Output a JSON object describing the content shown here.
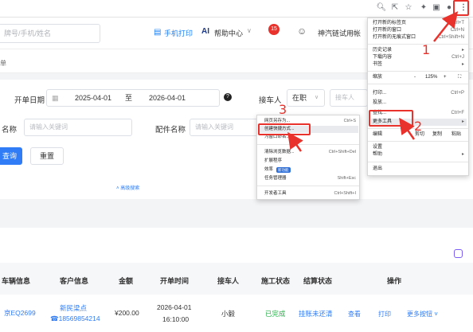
{
  "header": {
    "search_placeholder": "牌号/手机/姓名",
    "print_label": "手机打印",
    "help_label": "帮助中心",
    "notice_count": "15",
    "company": "神汽链试用帐"
  },
  "subbar": {
    "crumb": "单"
  },
  "filters": {
    "open_date_label": "开单日期",
    "date_from": "2025-04-01",
    "date_sep": "至",
    "date_to": "2026-04-01",
    "receiver_label": "接车人",
    "receiver_status": "在职",
    "receiver_placeholder": "接车人",
    "name_label": "名称",
    "name_placeholder": "请输入关键词",
    "part_label": "配件名称",
    "part_placeholder": "请输入关键词",
    "query_button": "查询",
    "reset_button": "重置",
    "advanced_search": "高级搜索"
  },
  "table": {
    "headers": [
      "车辆信息",
      "客户信息",
      "金额",
      "开单时间",
      "接车人",
      "施工状态",
      "结算状态",
      "操作"
    ],
    "row": {
      "vehicle": "京EQ2699",
      "customer_name": "新民梁点",
      "customer_phone": "18569854214",
      "amount": "¥200.00",
      "date": "2026-04-01",
      "time": "16:10:00",
      "receiver": "小毅",
      "work_status": "已完成",
      "settle_status": "挂账未还清",
      "action_view": "查看",
      "action_print": "打印",
      "action_more": "更多按钮"
    }
  },
  "chrome_menu": {
    "new_tab": "打开新的标签页",
    "new_tab_sc": "Ctrl+T",
    "new_window": "打开新的窗口",
    "new_window_sc": "Ctrl+N",
    "incognito": "打开新的无痕式窗口",
    "incognito_sc": "Ctrl+Shift+N",
    "history": "历史记录",
    "downloads": "下载内容",
    "downloads_sc": "Ctrl+J",
    "bookmarks": "书签",
    "zoom_label": "缩放",
    "zoom_minus": "-",
    "zoom_value": "125%",
    "zoom_plus": "+",
    "print": "打印...",
    "print_sc": "Ctrl+P",
    "cast": "投放...",
    "find": "查找...",
    "find_sc": "Ctrl+F",
    "more_tools": "更多工具",
    "edit_label": "编辑",
    "cut": "剪切",
    "copy": "复制",
    "paste": "粘贴",
    "settings": "设置",
    "help": "帮助",
    "exit": "退出"
  },
  "submenu": {
    "save_as": "网页另存为...",
    "save_as_sc": "Ctrl+S",
    "create_shortcut": "创建快捷方式...",
    "name_window": "为窗口命名...",
    "clear_data": "清除浏览数据...",
    "clear_data_sc": "Ctrl+Shift+Del",
    "extensions": "扩展程序",
    "performance": "效率",
    "performance_badge": "新功能",
    "task_manager": "任务管理器",
    "task_manager_sc": "Shift+Esc",
    "devtools": "开发者工具",
    "devtools_sc": "Ctrl+Shift+I"
  },
  "annotations": {
    "step1": "1",
    "step2": "2",
    "step3": "3"
  }
}
